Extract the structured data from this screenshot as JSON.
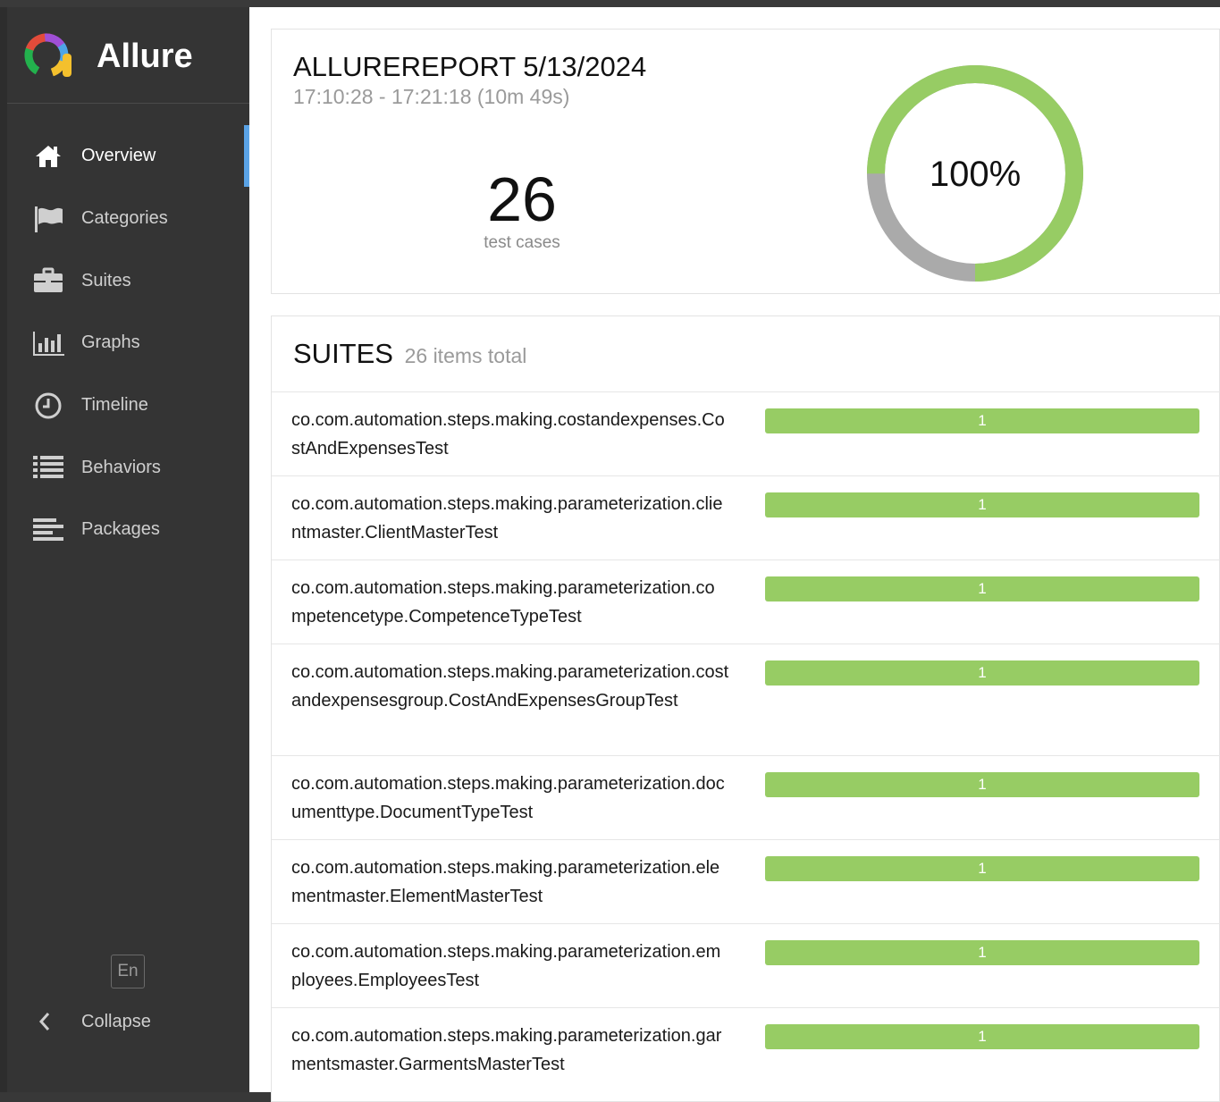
{
  "app": {
    "name": "Allure"
  },
  "sidebar": {
    "items": [
      {
        "label": "Overview",
        "icon": "home-icon",
        "active": true
      },
      {
        "label": "Categories",
        "icon": "flag-icon",
        "active": false
      },
      {
        "label": "Suites",
        "icon": "briefcase-icon",
        "active": false
      },
      {
        "label": "Graphs",
        "icon": "bar-chart-icon",
        "active": false
      },
      {
        "label": "Timeline",
        "icon": "clock-icon",
        "active": false
      },
      {
        "label": "Behaviors",
        "icon": "list-icon",
        "active": false
      },
      {
        "label": "Packages",
        "icon": "align-left-icon",
        "active": false
      }
    ],
    "language": "En",
    "collapse_label": "Collapse"
  },
  "summary": {
    "title": "ALLUREREPORT 5/13/2024",
    "time_range": "17:10:28 - 17:21:18 (10m 49s)",
    "test_count": "26",
    "test_count_label": "test cases",
    "pass_percent_label": "100%",
    "passed_fraction": 0.75,
    "colors": {
      "passed": "#97cc64",
      "other": "#aaaaaa"
    }
  },
  "suites": {
    "title": "SUITES",
    "subtitle": "26 items total",
    "items": [
      {
        "name": "co.com.automation.steps.making.costandexpenses.CostAndExpensesTest",
        "count": "1"
      },
      {
        "name": "co.com.automation.steps.making.parameterization.clientmaster.ClientMasterTest",
        "count": "1"
      },
      {
        "name": "co.com.automation.steps.making.parameterization.competencetype.CompetenceTypeTest",
        "count": "1"
      },
      {
        "name": "co.com.automation.steps.making.parameterization.costandexpensesgroup.CostAndExpensesGroupTest",
        "count": "1"
      },
      {
        "name": "co.com.automation.steps.making.parameterization.documenttype.DocumentTypeTest",
        "count": "1"
      },
      {
        "name": "co.com.automation.steps.making.parameterization.elementmaster.ElementMasterTest",
        "count": "1"
      },
      {
        "name": "co.com.automation.steps.making.parameterization.employees.EmployeesTest",
        "count": "1"
      },
      {
        "name": "co.com.automation.steps.making.parameterization.garmentsmaster.GarmentsMasterTest",
        "count": "1"
      }
    ]
  }
}
